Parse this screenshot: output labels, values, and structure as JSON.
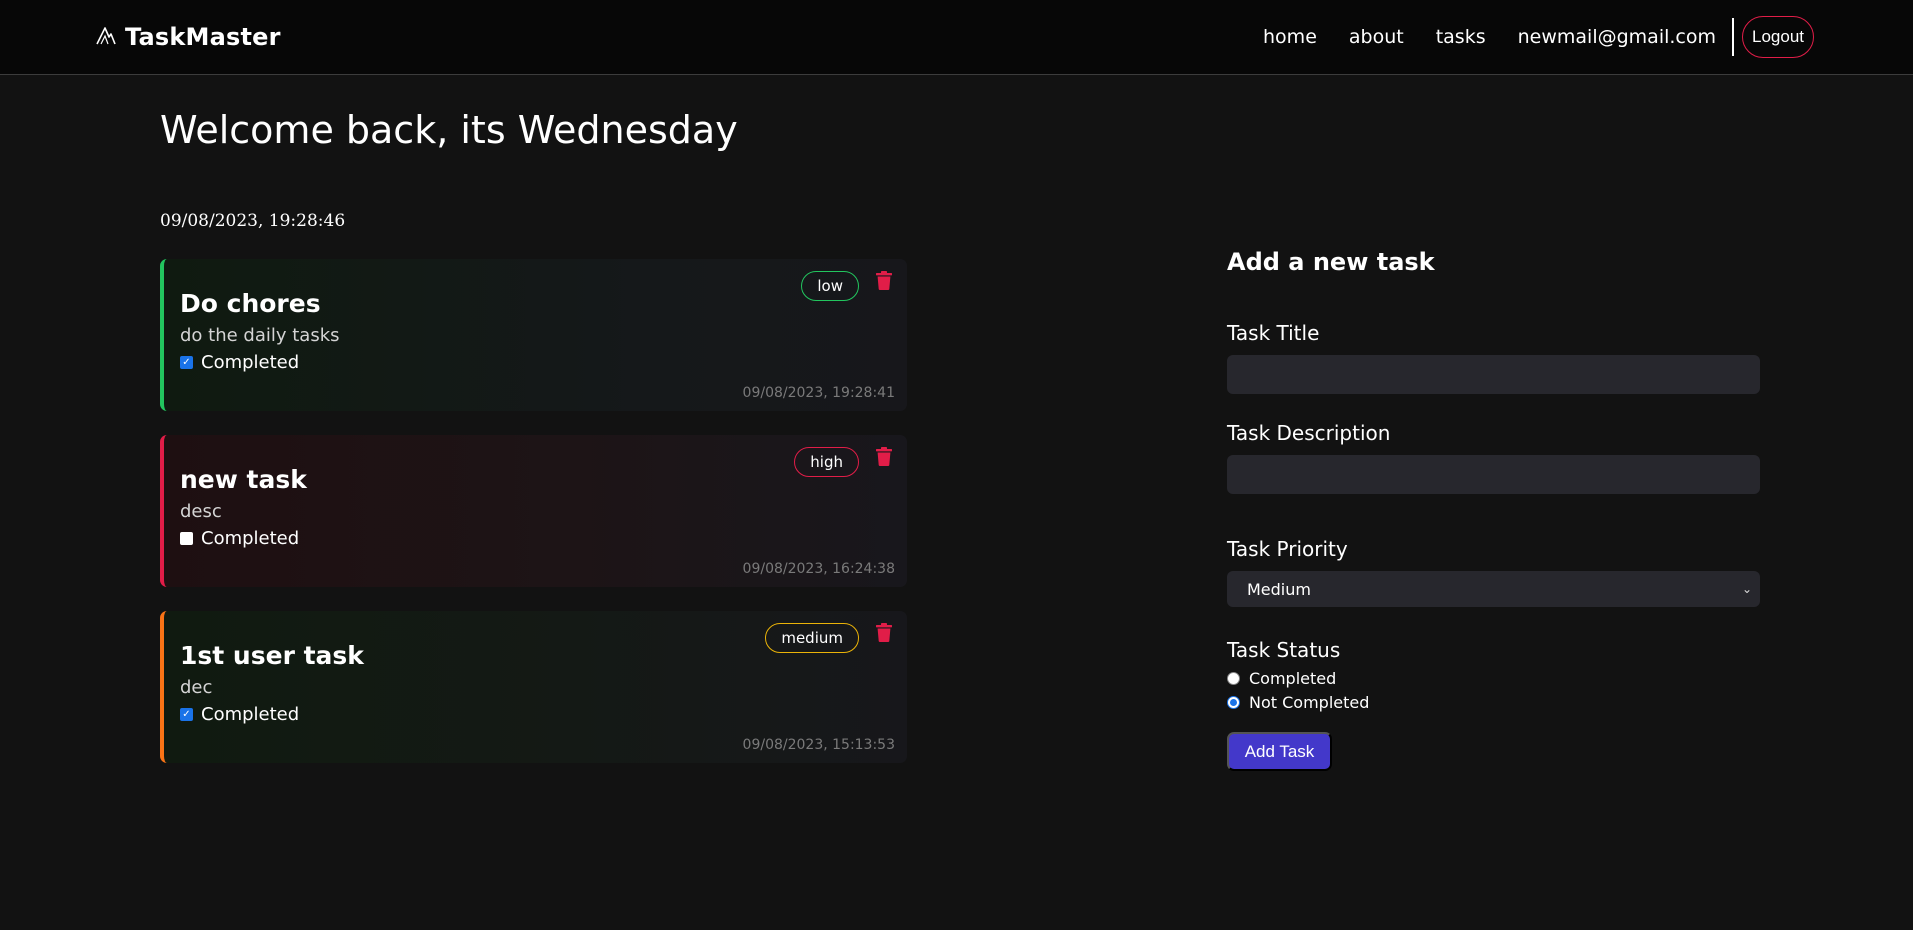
{
  "nav": {
    "brand": "TaskMaster",
    "links": [
      "home",
      "about",
      "tasks"
    ],
    "user_email": "newmail@gmail.com",
    "logout_label": "Logout"
  },
  "main": {
    "welcome": "Welcome back, its Wednesday",
    "clock": "09/08/2023, 19:28:46"
  },
  "tasks": [
    {
      "title": "Do chores",
      "description": "do the daily tasks",
      "completed_label": "Completed",
      "completed": true,
      "priority": "low",
      "priority_color": "#22c55e",
      "timestamp": "09/08/2023, 19:28:41"
    },
    {
      "title": "new task",
      "description": "desc",
      "completed_label": "Completed",
      "completed": false,
      "priority": "high",
      "priority_color": "#e11d48",
      "timestamp": "09/08/2023, 16:24:38"
    },
    {
      "title": "1st user task",
      "description": "dec",
      "completed_label": "Completed",
      "completed": true,
      "priority": "medium",
      "priority_color": "#f97316",
      "timestamp": "09/08/2023, 15:13:53"
    }
  ],
  "form": {
    "heading": "Add a new task",
    "title_label": "Task Title",
    "title_value": "",
    "description_label": "Task Description",
    "description_value": "",
    "priority_label": "Task Priority",
    "priority_selected": "Medium",
    "status_label": "Task Status",
    "status_options": [
      "Completed",
      "Not Completed"
    ],
    "status_selected": "Not Completed",
    "submit_label": "Add Task"
  },
  "colors": {
    "accent": "#4338ca",
    "danger": "#e11d48",
    "background": "#121212"
  }
}
